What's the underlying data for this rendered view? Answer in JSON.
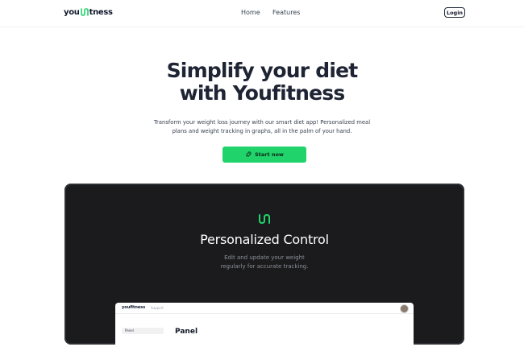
{
  "nav": {
    "logo_left": "you",
    "logo_right": "tness",
    "links": [
      "Home",
      "Features"
    ],
    "login_label": "Login"
  },
  "hero": {
    "title_line1": "Simplify your diet",
    "title_line2": "with Youfitness",
    "subtitle_line1": "Transform your weight loss journey with our smart diet app! Personalized meal",
    "subtitle_line2": "plans and weight tracking in graphs, all in the palm of your hand.",
    "cta_label": "Start now",
    "cta_icon": "rocket-icon"
  },
  "feature": {
    "icon": "youfitness-logo-icon",
    "title": "Personalized Control",
    "subtitle_line1": "Edit and update your weight",
    "subtitle_line2": "regularly for accurate tracking."
  },
  "mock_app": {
    "logo": "youfitness",
    "support_label": "Support",
    "sidebar_item": "Panel",
    "heading": "Panel"
  },
  "colors": {
    "accent": "#20d36b",
    "panel_bg": "#1b1b1d",
    "title": "#1e2433"
  }
}
